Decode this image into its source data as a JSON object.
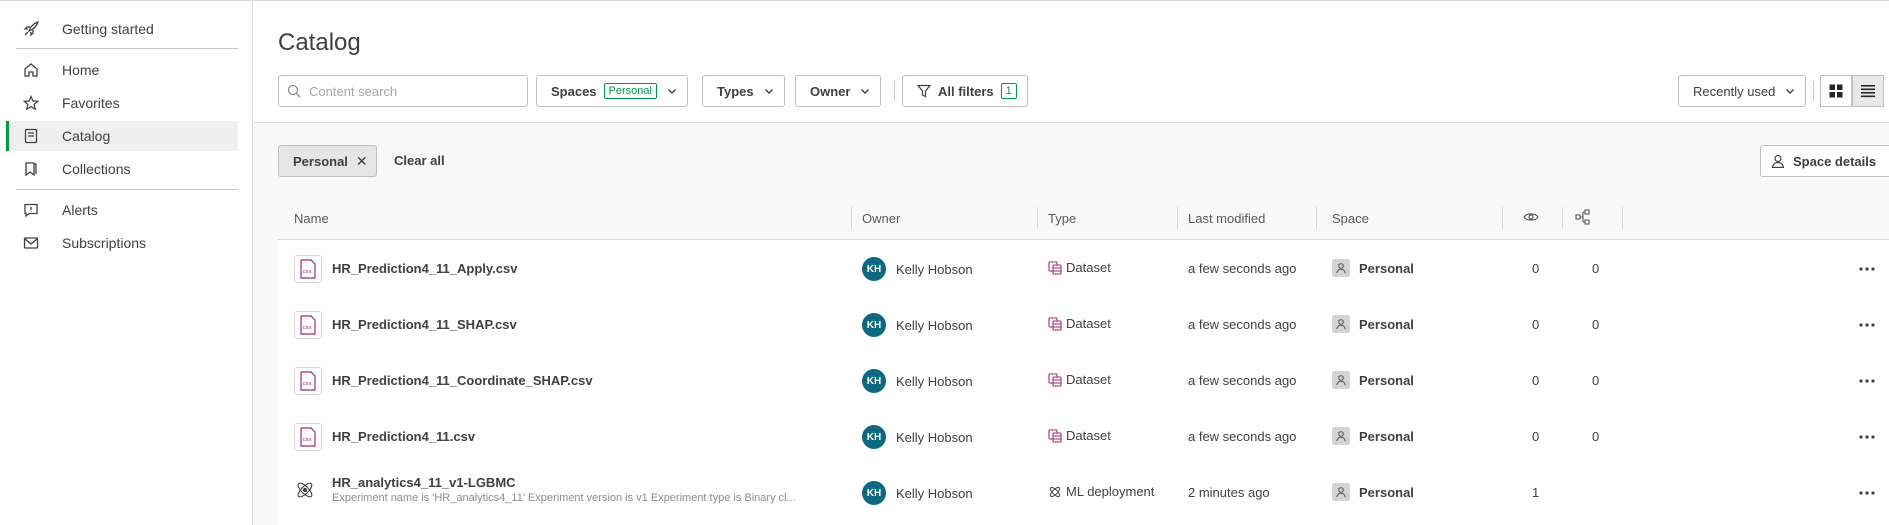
{
  "sidebar": {
    "items": [
      {
        "label": "Getting started",
        "icon": "rocket-icon"
      },
      {
        "label": "Home",
        "icon": "home-icon"
      },
      {
        "label": "Favorites",
        "icon": "star-icon"
      },
      {
        "label": "Catalog",
        "icon": "catalog-icon",
        "active": true
      },
      {
        "label": "Collections",
        "icon": "bookmark-icon"
      },
      {
        "label": "Alerts",
        "icon": "alert-icon"
      },
      {
        "label": "Subscriptions",
        "icon": "mail-icon"
      }
    ]
  },
  "page": {
    "title": "Catalog"
  },
  "toolbar": {
    "search_placeholder": "Content search",
    "spaces_label": "Spaces",
    "spaces_badge": "Personal",
    "types_label": "Types",
    "owner_label": "Owner",
    "all_filters_label": "All filters",
    "all_filters_count": "1",
    "sort_label": "Recently used"
  },
  "filters": {
    "chip_label": "Personal",
    "clear_all_label": "Clear all",
    "space_details_label": "Space details"
  },
  "table": {
    "headers": {
      "name": "Name",
      "owner": "Owner",
      "type": "Type",
      "last_modified": "Last modified",
      "space": "Space"
    },
    "rows": [
      {
        "name": "HR_Prediction4_11_Apply.csv",
        "subtitle": "",
        "icon": "csv-file-icon",
        "owner_initials": "KH",
        "owner": "Kelly Hobson",
        "type": "Dataset",
        "type_icon": "dataset-icon",
        "modified": "a few seconds ago",
        "space": "Personal",
        "views": "0",
        "lineage": "0"
      },
      {
        "name": "HR_Prediction4_11_SHAP.csv",
        "subtitle": "",
        "icon": "csv-file-icon",
        "owner_initials": "KH",
        "owner": "Kelly Hobson",
        "type": "Dataset",
        "type_icon": "dataset-icon",
        "modified": "a few seconds ago",
        "space": "Personal",
        "views": "0",
        "lineage": "0"
      },
      {
        "name": "HR_Prediction4_11_Coordinate_SHAP.csv",
        "subtitle": "",
        "icon": "csv-file-icon",
        "owner_initials": "KH",
        "owner": "Kelly Hobson",
        "type": "Dataset",
        "type_icon": "dataset-icon",
        "modified": "a few seconds ago",
        "space": "Personal",
        "views": "0",
        "lineage": "0"
      },
      {
        "name": "HR_Prediction4_11.csv",
        "subtitle": "",
        "icon": "csv-file-icon",
        "owner_initials": "KH",
        "owner": "Kelly Hobson",
        "type": "Dataset",
        "type_icon": "dataset-icon",
        "modified": "a few seconds ago",
        "space": "Personal",
        "views": "0",
        "lineage": "0"
      },
      {
        "name": "HR_analytics4_11_v1-LGBMC",
        "subtitle": "Experiment name is 'HR_analytics4_11' Experiment version is v1 Experiment type is Binary cl...",
        "icon": "ml-deployment-icon",
        "owner_initials": "KH",
        "owner": "Kelly Hobson",
        "type": "ML deployment",
        "type_icon": "ml-deployment-icon",
        "modified": "2 minutes ago",
        "space": "Personal",
        "views": "1",
        "lineage": ""
      }
    ]
  },
  "colors": {
    "accent": "#009845",
    "avatar": "#0d6980",
    "dataset": "#9e2a7a"
  }
}
